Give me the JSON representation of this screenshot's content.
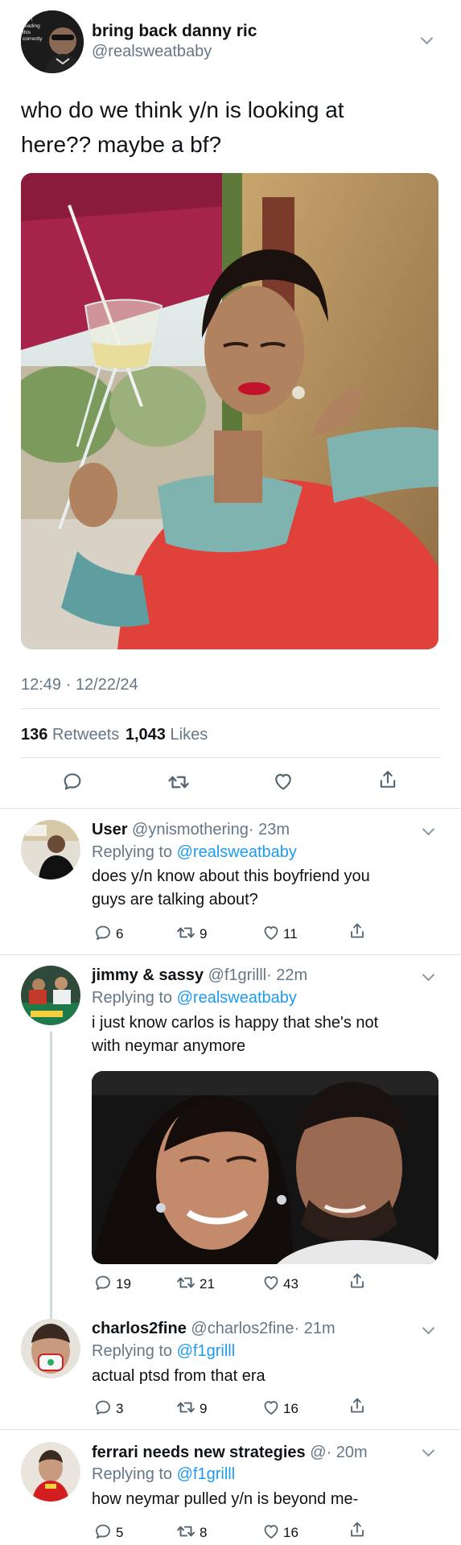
{
  "tweet": {
    "display_name": "bring back danny ric",
    "handle": "@realsweatbaby",
    "avatar_text": [
      "am i",
      "reading",
      "this",
      "correctly"
    ],
    "text_line1": "who do we think y/n is looking at",
    "text_line2": "here?? maybe a bf?",
    "timestamp": "12:49 · 12/22/24",
    "retweets_count": "136",
    "retweets_label": "Retweets",
    "likes_count": "1,043",
    "likes_label": "Likes"
  },
  "replies": [
    {
      "display_name": "User",
      "handle": "@ynismothering",
      "time": "· 23m",
      "replying_to_label": "Replying to",
      "replying_to": "@realsweatbaby",
      "text_line1": "does y/n know about this boyfriend you",
      "text_line2": "guys are talking about?",
      "replies": "6",
      "retweets": "9",
      "likes": "11"
    },
    {
      "display_name": "jimmy & sassy",
      "handle": "@f1grilll",
      "time": "· 22m",
      "replying_to_label": "Replying to",
      "replying_to": "@realsweatbaby",
      "text_line1": "i just know carlos is happy that she's not",
      "text_line2": "with neymar anymore",
      "replies": "19",
      "retweets": "21",
      "likes": "43"
    },
    {
      "display_name": "charlos2fine",
      "handle": "@charlos2fine",
      "time": "· 21m",
      "replying_to_label": "Replying to",
      "replying_to": "@f1grilll",
      "text_line1": "actual ptsd from that era",
      "replies": "3",
      "retweets": "9",
      "likes": "16"
    },
    {
      "display_name": "ferrari needs new strategies",
      "handle": "@",
      "time": "· 20m",
      "replying_to_label": "Replying to",
      "replying_to": "@f1grilll",
      "text_line1": "how neymar pulled y/n is beyond me-",
      "replies": "5",
      "retweets": "8",
      "likes": "16"
    }
  ],
  "icons": {
    "reply": "speech-bubble-icon",
    "retweet": "retweet-arrows-icon",
    "like": "heart-icon",
    "share": "share-upload-icon",
    "menu": "chevron-down-icon"
  },
  "colors": {
    "link_blue": "#1d9bf0",
    "secondary_grey": "#657786",
    "divider": "#dfe3e6"
  }
}
